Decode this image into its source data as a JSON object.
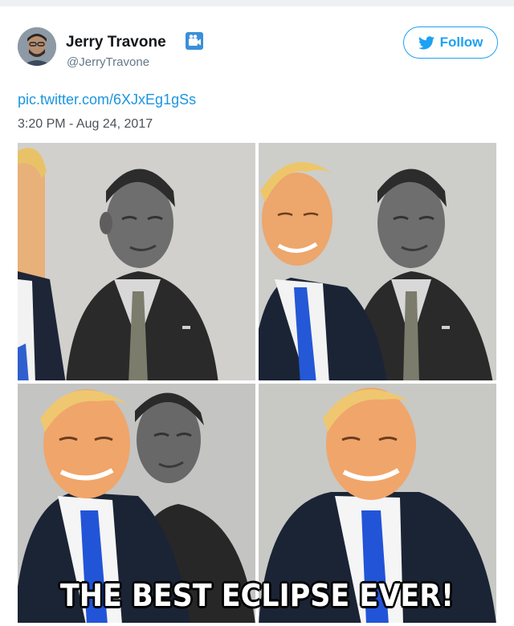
{
  "tweet": {
    "author_name": "Jerry Travone",
    "author_handle": "@JerryTravone",
    "follow_label": "Follow",
    "link_text": "pic.twitter.com/6XJxEg1gSs",
    "timestamp": "3:20 PM - Aug 24, 2017"
  },
  "media": {
    "caption": "THE BEST ECLIPSE EVER!"
  },
  "colors": {
    "accent": "#1da1f2",
    "link": "#1b95e0",
    "handle": "#657786"
  },
  "icons": {
    "verified": "badge-icon",
    "follow": "twitter-bird-icon"
  }
}
